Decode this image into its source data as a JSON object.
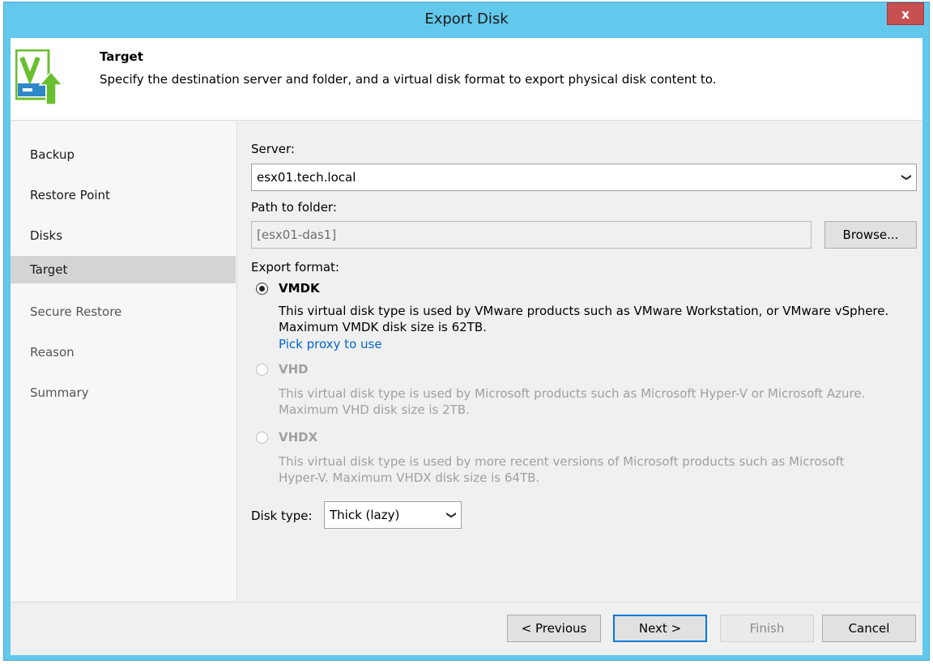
{
  "window": {
    "title": "Export Disk",
    "close_label": "x"
  },
  "header": {
    "title": "Target",
    "description": "Specify the destination server and folder, and a virtual disk format to export physical disk content to.",
    "logo_icon": "veeam-export-icon"
  },
  "sidebar": {
    "items": [
      {
        "label": "Backup",
        "state": "normal"
      },
      {
        "label": "Restore Point",
        "state": "normal"
      },
      {
        "label": "Disks",
        "state": "normal"
      },
      {
        "label": "Target",
        "state": "active"
      },
      {
        "label": "Secure Restore",
        "state": "dim"
      },
      {
        "label": "Reason",
        "state": "dim"
      },
      {
        "label": "Summary",
        "state": "dim"
      }
    ]
  },
  "form": {
    "server_label": "Server:",
    "server_value": "esx01.tech.local",
    "path_label": "Path to folder:",
    "path_value": "[esx01-das1]",
    "browse_label": "Browse...",
    "export_format_label": "Export format:",
    "formats": [
      {
        "title": "VMDK",
        "selected": true,
        "enabled": true,
        "desc_line1": "This virtual disk type is used by VMware products such as VMware Workstation, or VMware vSphere.",
        "desc_line2": "Maximum VMDK disk size is 62TB."
      },
      {
        "title": "VHD",
        "selected": false,
        "enabled": false,
        "desc_line1": "This virtual disk type is used by Microsoft products such as Microsoft Hyper-V or Microsoft Azure.",
        "desc_line2": "Maximum VHD disk size is 2TB."
      },
      {
        "title": "VHDX",
        "selected": false,
        "enabled": false,
        "desc_line1": "This virtual disk type is used by more recent versions of Microsoft products such as Microsoft",
        "desc_line2": "Hyper-V. Maximum VHDX disk size is 64TB."
      }
    ],
    "pick_proxy_link": "Pick proxy to use",
    "disk_type_label": "Disk type:",
    "disk_type_value": "Thick (lazy)"
  },
  "footer": {
    "previous_label": "< Previous",
    "next_label": "Next >",
    "finish_label": "Finish",
    "cancel_label": "Cancel"
  },
  "colors": {
    "title_bar": "#62c8ec",
    "close_button": "#c75050",
    "link": "#0066cc",
    "logo_green": "#6abf2e",
    "logo_blue": "#2f86c8"
  }
}
